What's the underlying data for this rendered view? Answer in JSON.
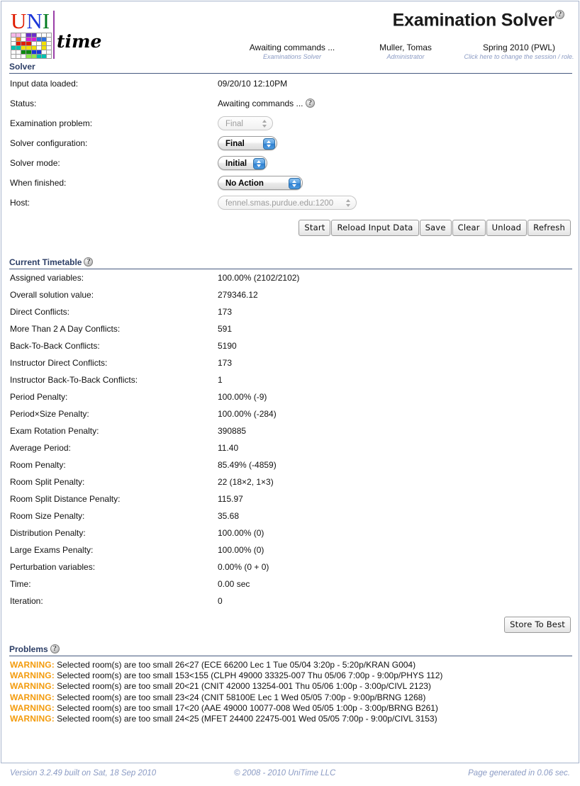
{
  "app": {
    "title": "Examination Solver",
    "help_icon": "help-question-icon",
    "logo": {
      "text_uni": "UNI",
      "text_time": "time"
    }
  },
  "header": {
    "cells": [
      {
        "main": "Awaiting commands ...",
        "sub": "Examinations Solver"
      },
      {
        "main": "Muller, Tomas",
        "sub": "Administrator"
      },
      {
        "main": "Spring 2010 (PWL)",
        "sub": "Click here to change the session / role."
      }
    ]
  },
  "solver": {
    "heading": "Solver",
    "rows": [
      {
        "label": "Input data loaded:",
        "value": "09/20/10 12:10PM"
      },
      {
        "label": "Status:",
        "value": "Awaiting commands ..."
      },
      {
        "label": "Examination problem:",
        "value": "Final"
      },
      {
        "label": "Solver configuration:",
        "value": "Final"
      },
      {
        "label": "Solver mode:",
        "value": "Initial"
      },
      {
        "label": "When finished:",
        "value": "No Action"
      },
      {
        "label": "Host:",
        "value": "fennel.smas.purdue.edu:1200"
      }
    ],
    "selects": {
      "examination_problem": {
        "value": "Final",
        "enabled": false,
        "width": 78
      },
      "solver_configuration": {
        "value": "Final",
        "enabled": true,
        "width": 84
      },
      "solver_mode": {
        "value": "Initial",
        "enabled": true,
        "width": 70
      },
      "when_finished": {
        "value": "No Action",
        "enabled": true,
        "width": 120
      },
      "host": {
        "value": "fennel.smas.purdue.edu:1200",
        "enabled": false,
        "width": 196
      }
    },
    "buttons": [
      "Start",
      "Reload Input Data",
      "Save",
      "Clear",
      "Unload",
      "Refresh"
    ]
  },
  "current_timetable": {
    "heading": "Current Timetable",
    "rows": [
      {
        "label": "Assigned variables:",
        "value": "100.00% (2102/2102)"
      },
      {
        "label": "Overall solution value:",
        "value": "279346.12"
      },
      {
        "label": "Direct Conflicts:",
        "value": "173"
      },
      {
        "label": "More Than 2 A Day Conflicts:",
        "value": "591"
      },
      {
        "label": "Back-To-Back Conflicts:",
        "value": "5190"
      },
      {
        "label": "Instructor Direct Conflicts:",
        "value": "173"
      },
      {
        "label": "Instructor Back-To-Back Conflicts:",
        "value": "1"
      },
      {
        "label": "Period Penalty:",
        "value": "100.00% (-9)"
      },
      {
        "label": "Period×Size Penalty:",
        "value": "100.00% (-284)"
      },
      {
        "label": "Exam Rotation Penalty:",
        "value": "390885"
      },
      {
        "label": "Average Period:",
        "value": "11.40"
      },
      {
        "label": "Room Penalty:",
        "value": "85.49% (-4859)"
      },
      {
        "label": "Room Split Penalty:",
        "value": "22 (18×2, 1×3)"
      },
      {
        "label": "Room Split Distance Penalty:",
        "value": "115.97"
      },
      {
        "label": "Room Size Penalty:",
        "value": "35.68"
      },
      {
        "label": "Distribution Penalty:",
        "value": "100.00% (0)"
      },
      {
        "label": "Large Exams Penalty:",
        "value": "100.00% (0)"
      },
      {
        "label": "Perturbation variables:",
        "value": "0.00% (0 + 0)"
      },
      {
        "label": "Time:",
        "value": "0.00 sec"
      },
      {
        "label": "Iteration:",
        "value": "0"
      }
    ],
    "store_to_best_label": "Store To Best"
  },
  "problems": {
    "heading": "Problems",
    "warning_tag": "WARNING:",
    "items": [
      "Selected room(s) are too small 26<27 (ECE 66200 Lec 1 Tue 05/04 3:20p - 5:20p/KRAN G004)",
      "Selected room(s) are too small 153<155 (CLPH 49000 33325-007 Thu 05/06 7:00p - 9:00p/PHYS 112)",
      "Selected room(s) are too small 20<21 (CNIT 42000 13254-001 Thu 05/06 1:00p - 3:00p/CIVL 2123)",
      "Selected room(s) are too small 23<24 (CNIT 58100E Lec 1 Wed 05/05 7:00p - 9:00p/BRNG 1268)",
      "Selected room(s) are too small 17<20 (AAE 49000 10077-008 Wed 05/05 1:00p - 3:00p/BRNG B261)",
      "Selected room(s) are too small 24<25 (MFET 24400 22475-001 Wed 05/05 7:00p - 9:00p/CIVL 3153)"
    ]
  },
  "footer": {
    "version": "Version 3.2.49 built on Sat, 18 Sep 2010",
    "copyright": "© 2008 - 2010 UniTime LLC",
    "generated": "Page generated in 0.06 sec."
  },
  "colors": {
    "heading": "#2c3e66",
    "warning": "#f39b0c",
    "footer_text": "#8b9bc4",
    "border": "#a8b4cc",
    "accent_blue": "#2f7fd0"
  }
}
